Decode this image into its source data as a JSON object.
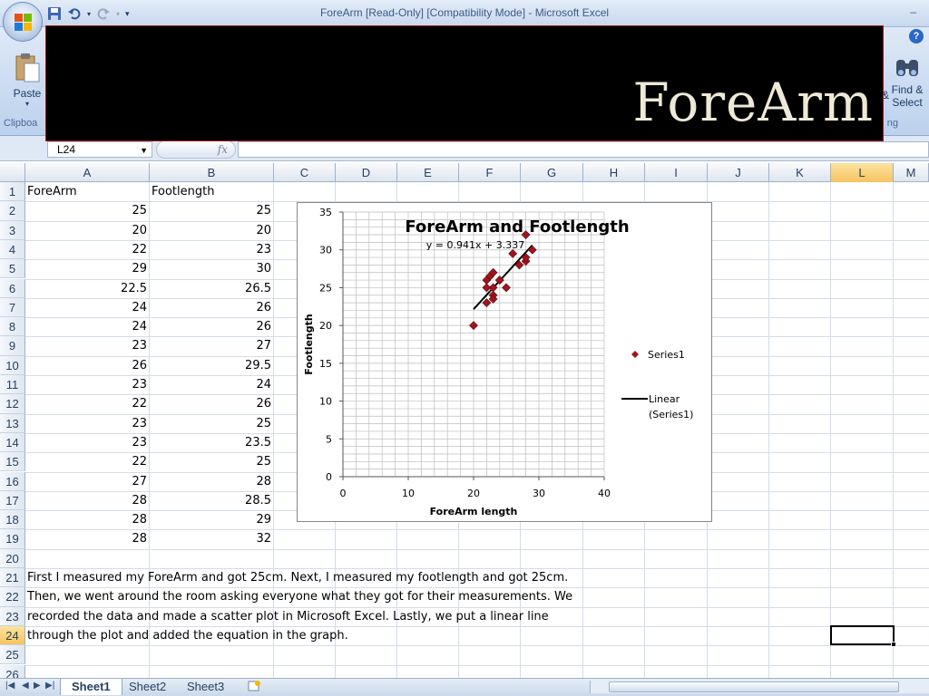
{
  "window": {
    "title": "ForeArm  [Read-Only]  [Compatibility Mode] - Microsoft Excel",
    "minimize": "–"
  },
  "ribbon": {
    "paste_label": "Paste",
    "clipboard_group": "Clipboa",
    "find_label_1": "Find &",
    "find_label_2": "Select",
    "sort_fragment": "&",
    "editing_fragment": "ng",
    "help": "?"
  },
  "banner": {
    "title": "ForeArm"
  },
  "formula_bar": {
    "name_box": "L24",
    "fx": "fx",
    "content": ""
  },
  "columns": [
    "A",
    "B",
    "C",
    "D",
    "E",
    "F",
    "G",
    "H",
    "I",
    "J",
    "K",
    "L",
    "M"
  ],
  "selected_column": "L",
  "rows": [
    "1",
    "2",
    "3",
    "4",
    "5",
    "6",
    "7",
    "8",
    "9",
    "10",
    "11",
    "12",
    "13",
    "14",
    "15",
    "16",
    "17",
    "18",
    "19",
    "20",
    "21",
    "22",
    "23",
    "24",
    "25",
    "26"
  ],
  "selected_row": "24",
  "sheet": {
    "header_a": "ForeArm",
    "header_b": "Footlength",
    "data": [
      [
        "25",
        "25"
      ],
      [
        "20",
        "20"
      ],
      [
        "22",
        "23"
      ],
      [
        "29",
        "30"
      ],
      [
        "22.5",
        "26.5"
      ],
      [
        "24",
        "26"
      ],
      [
        "24",
        "26"
      ],
      [
        "23",
        "27"
      ],
      [
        "26",
        "29.5"
      ],
      [
        "23",
        "24"
      ],
      [
        "22",
        "26"
      ],
      [
        "23",
        "25"
      ],
      [
        "23",
        "23.5"
      ],
      [
        "22",
        "25"
      ],
      [
        "27",
        "28"
      ],
      [
        "28",
        "28.5"
      ],
      [
        "28",
        "29"
      ],
      [
        "28",
        "32"
      ]
    ],
    "notes": [
      "First I measured my ForeArm and got 25cm. Next, I measured my footlength and got 25cm.",
      "Then, we went around the room asking everyone what they got for their measurements. We",
      "recorded the data and made a scatter plot in Microsoft Excel. Lastly, we put a linear line",
      "through the plot and added the equation in the graph."
    ]
  },
  "tabs": [
    "Sheet1",
    "Sheet2",
    "Sheet3"
  ],
  "active_tab": "Sheet1",
  "chart_data": {
    "type": "scatter",
    "title": "ForeArm and Footlength",
    "xlabel": "ForeArm length",
    "ylabel": "Footlength",
    "xlim": [
      0,
      40
    ],
    "ylim": [
      0,
      35
    ],
    "x_ticks": [
      "0",
      "10",
      "20",
      "30",
      "40"
    ],
    "y_ticks": [
      "0",
      "5",
      "10",
      "15",
      "20",
      "25",
      "30",
      "35"
    ],
    "grid": true,
    "legend_position": "right",
    "marker_color": "#a0141e",
    "series": [
      {
        "name": "Series1",
        "x": [
          25,
          20,
          22,
          29,
          22.5,
          24,
          24,
          23,
          26,
          23,
          22,
          23,
          23,
          22,
          27,
          28,
          28,
          28
        ],
        "y": [
          25,
          20,
          23,
          30,
          26.5,
          26,
          26,
          27,
          29.5,
          24,
          26,
          25,
          23.5,
          25,
          28,
          28.5,
          29,
          32
        ]
      }
    ],
    "trendline": {
      "name": "Linear (Series1)",
      "slope": 0.941,
      "intercept": 3.337,
      "x_range": [
        20,
        29
      ],
      "equation": "y = 0.941x + 3.337"
    }
  }
}
